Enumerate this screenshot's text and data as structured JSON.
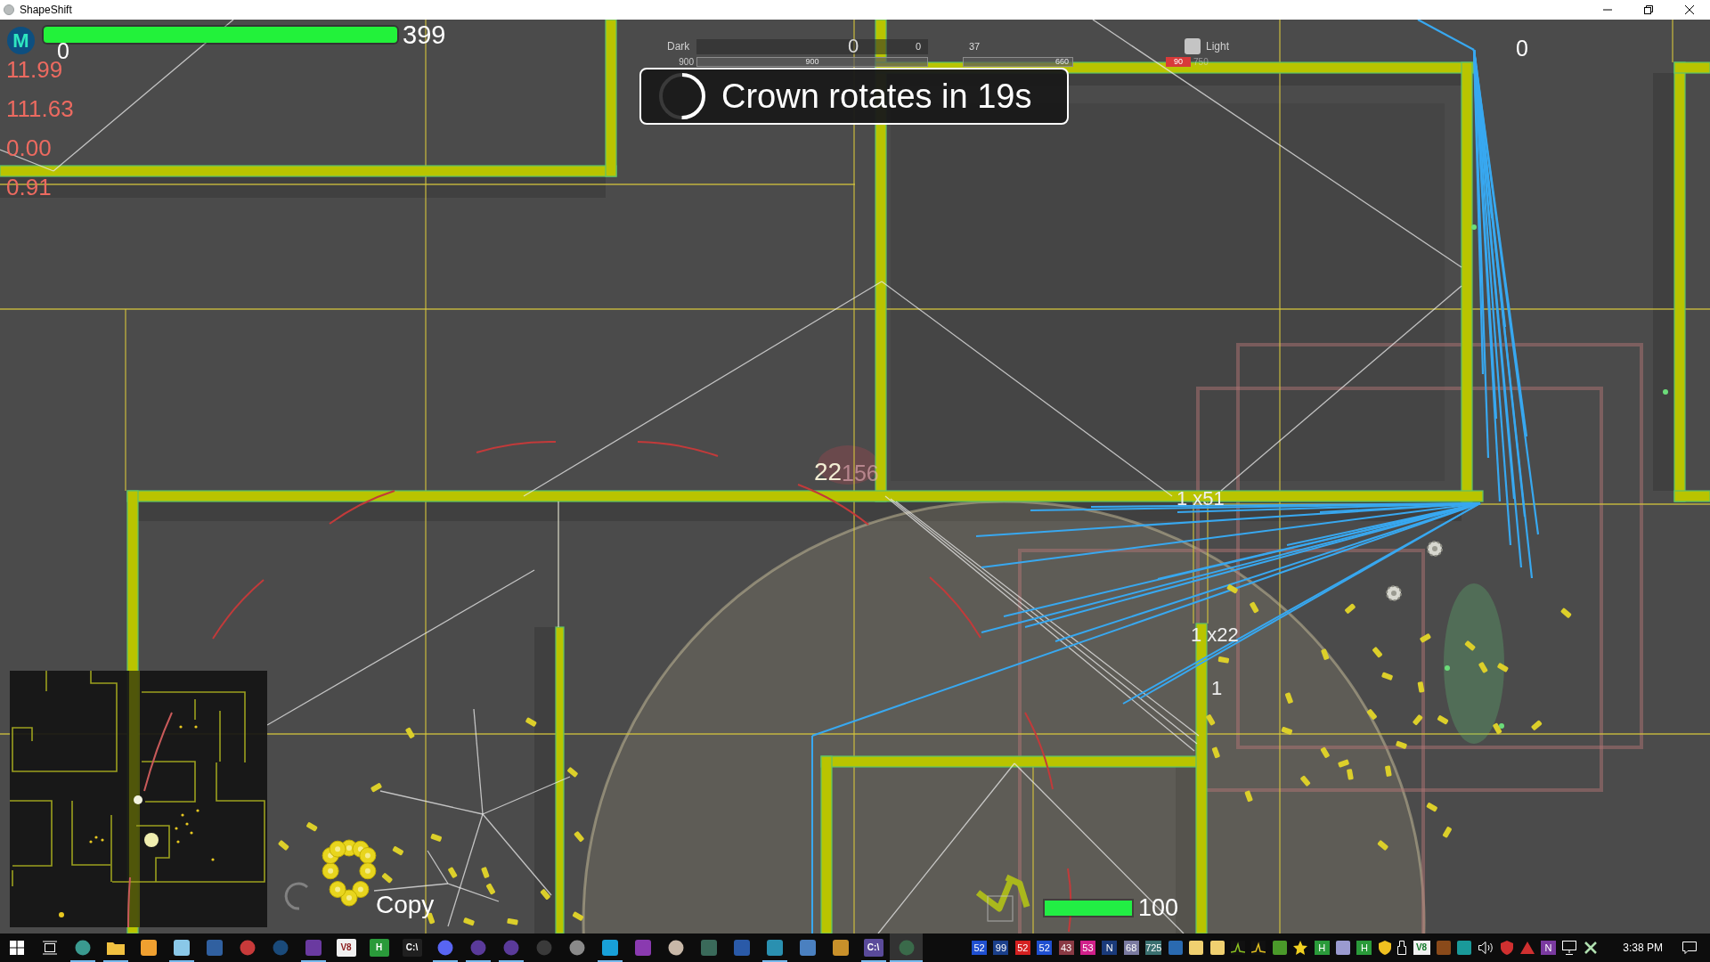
{
  "window": {
    "title": "ShapeShift",
    "controls": [
      {
        "kind": "minimize"
      },
      {
        "kind": "restore"
      },
      {
        "kind": "close"
      }
    ]
  },
  "hud": {
    "player": {
      "initial": "M",
      "health": {
        "level": 1,
        "reading": "399"
      },
      "score": "0"
    },
    "stats": [
      "11.99",
      "111.63",
      "0.00",
      "0.91"
    ],
    "team_bar": {
      "dark_label": "Dark",
      "dark_marker": "0",
      "dark_score": "0",
      "light_score": "37",
      "light_label": "Light",
      "row_2": [
        {
          "kind": "plain",
          "text": "900"
        },
        {
          "kind": "bar",
          "text": "900"
        },
        {
          "kind": "bar",
          "text": "660"
        },
        {
          "kind": "tag",
          "text": "90"
        },
        {
          "kind": "faint",
          "text": "750"
        }
      ]
    },
    "banner": {
      "text": "Crown rotates in 19s",
      "level": 0.5
    },
    "corner_score": "0",
    "labels": [
      {
        "kind": "hit",
        "text": "22"
      },
      {
        "kind": "faint",
        "text": "156"
      },
      {
        "kind": "count",
        "text": "1 x51"
      },
      {
        "kind": "count",
        "text": "1 x22"
      },
      {
        "kind": "count",
        "text": "1"
      },
      {
        "kind": "name",
        "text": "Copy"
      }
    ],
    "unit": {
      "level": 1,
      "reading": "100"
    }
  },
  "taskbar": {
    "apps": [
      {
        "kind": "windows",
        "running": false,
        "selected": false
      },
      {
        "kind": "taskview",
        "running": false,
        "selected": false
      },
      {
        "kind": "circle",
        "color": "#3a9a90",
        "running": true,
        "selected": false
      },
      {
        "kind": "folder",
        "color": "#f0c040",
        "running": true,
        "selected": false
      },
      {
        "kind": "tile",
        "color": "#f0a030",
        "running": false,
        "selected": false
      },
      {
        "kind": "tile",
        "color": "#8ac8e8",
        "running": true,
        "selected": false
      },
      {
        "kind": "tile",
        "color": "#3060a0",
        "running": false,
        "selected": false
      },
      {
        "kind": "circle",
        "color": "#c83a3a",
        "running": false,
        "selected": false
      },
      {
        "kind": "circle",
        "color": "#1a4a7a",
        "running": false,
        "selected": false
      },
      {
        "kind": "tile",
        "color": "#6a3aa0",
        "running": true,
        "selected": false
      },
      {
        "kind": "text",
        "label": "V8",
        "color": "#f0f0f0",
        "running": false,
        "selected": false
      },
      {
        "kind": "text",
        "label": "H",
        "color": "#2a9a3a",
        "running": false,
        "selected": false
      },
      {
        "kind": "text",
        "label": "C:\\",
        "color": "#202020",
        "running": false,
        "selected": false
      },
      {
        "kind": "circle",
        "color": "#5865f2",
        "running": true,
        "selected": false
      },
      {
        "kind": "circle",
        "color": "#5a3a9a",
        "running": true,
        "selected": false
      },
      {
        "kind": "circle",
        "color": "#5a3a9a",
        "running": true,
        "selected": false
      },
      {
        "kind": "circle",
        "color": "#3a3a3a",
        "running": false,
        "selected": false
      },
      {
        "kind": "circle",
        "color": "#8a8a8a",
        "running": false,
        "selected": false
      },
      {
        "kind": "tile",
        "color": "#18a0d8",
        "running": true,
        "selected": false
      },
      {
        "kind": "tile",
        "color": "#8a3ab0",
        "running": false,
        "selected": false
      },
      {
        "kind": "circle",
        "color": "#c8b8a8",
        "running": false,
        "selected": false
      },
      {
        "kind": "tile",
        "color": "#3a6a5a",
        "running": false,
        "selected": false
      },
      {
        "kind": "tile",
        "color": "#2a5aa8",
        "running": false,
        "selected": false
      },
      {
        "kind": "tile",
        "color": "#2a90b0",
        "running": true,
        "selected": false
      },
      {
        "kind": "tile",
        "color": "#4a80c0",
        "running": false,
        "selected": false
      },
      {
        "kind": "tile",
        "color": "#c8902a",
        "running": false,
        "selected": false
      },
      {
        "kind": "text",
        "label": "C:\\",
        "color": "#5a4a9a",
        "running": true,
        "selected": false
      },
      {
        "kind": "circle",
        "color": "#3a6a4a",
        "running": true,
        "selected": true
      }
    ],
    "tray": [
      {
        "kind": "badge",
        "text": "52",
        "color": "#1f4fd0"
      },
      {
        "kind": "badge",
        "text": "99",
        "color": "#1a3f8a"
      },
      {
        "kind": "badge",
        "text": "52",
        "color": "#d42020"
      },
      {
        "kind": "badge",
        "text": "52",
        "color": "#1f4fd0"
      },
      {
        "kind": "badge",
        "text": "43",
        "color": "#8a3a44"
      },
      {
        "kind": "badge",
        "text": "53",
        "color": "#d0208a"
      },
      {
        "kind": "badge",
        "text": "N",
        "color": "#1a3a7a"
      },
      {
        "kind": "badge",
        "text": "68",
        "color": "#7a7aa0"
      },
      {
        "kind": "badge",
        "text": "725",
        "color": "#3a7070"
      },
      {
        "kind": "tile",
        "color": "#2a6ab0"
      },
      {
        "kind": "tile",
        "color": "#f0d070"
      },
      {
        "kind": "tile",
        "color": "#f0d070"
      },
      {
        "kind": "chart",
        "color": "#8ac020"
      },
      {
        "kind": "chart",
        "color": "#e0c020"
      },
      {
        "kind": "tile",
        "color": "#4a9a2a"
      },
      {
        "kind": "star",
        "color": "#f0d020"
      },
      {
        "kind": "letter",
        "text": "H",
        "color": "#2a9a3a"
      },
      {
        "kind": "tile",
        "color": "#9a9ad0"
      },
      {
        "kind": "letter",
        "text": "H",
        "color": "#2a9a3a"
      },
      {
        "kind": "shield",
        "color": "#f0c020"
      },
      {
        "kind": "plug"
      },
      {
        "kind": "letter",
        "text": "V8",
        "color": "#f0f0f0"
      },
      {
        "kind": "tile",
        "color": "#8a4a1a"
      },
      {
        "kind": "tile",
        "color": "#1a9a9a"
      },
      {
        "kind": "speaker"
      },
      {
        "kind": "shield",
        "color": "#d03030"
      },
      {
        "kind": "triangle",
        "color": "#d03030"
      },
      {
        "kind": "letter",
        "text": "N",
        "color": "#7a3aa0"
      },
      {
        "kind": "monitor"
      },
      {
        "kind": "cross",
        "color": "#b0e0b0"
      }
    ],
    "clock": "3:38 PM"
  }
}
